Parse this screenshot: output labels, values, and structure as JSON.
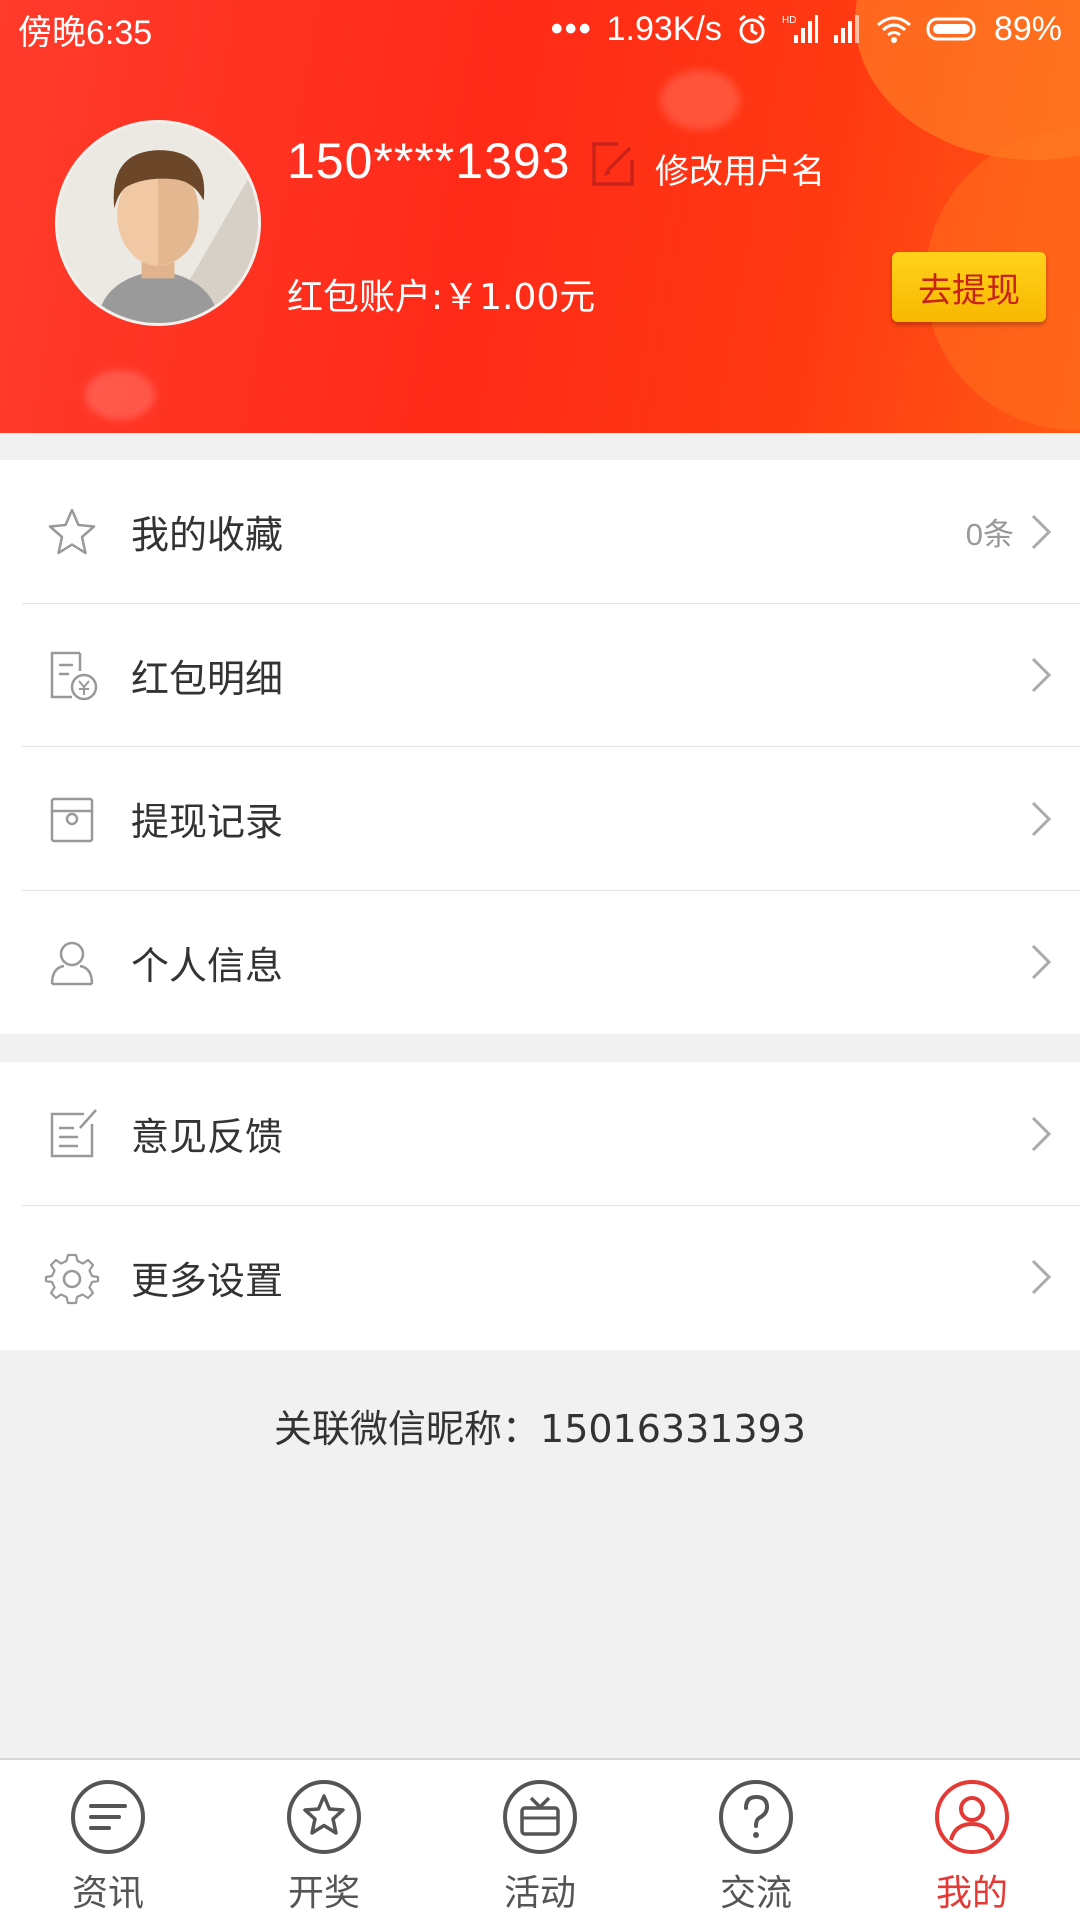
{
  "status_bar": {
    "time": "傍晚6:35",
    "network_speed": "1.93K/s",
    "battery": "89%"
  },
  "header": {
    "username": "150****1393",
    "edit_label": "修改用户名",
    "balance_label": "红包账户:￥1.00元",
    "withdraw_button": "去提现",
    "bg_color": "#ff2a18",
    "button_color": "#f7b800"
  },
  "menu_group_1": [
    {
      "label": "我的收藏",
      "count": "0条",
      "icon": "star-icon"
    },
    {
      "label": "红包明细",
      "count": "",
      "icon": "red-packet-detail-icon"
    },
    {
      "label": "提现记录",
      "count": "",
      "icon": "withdraw-record-icon"
    },
    {
      "label": "个人信息",
      "count": "",
      "icon": "person-icon"
    }
  ],
  "menu_group_2": [
    {
      "label": "意见反馈",
      "icon": "feedback-icon"
    },
    {
      "label": "更多设置",
      "icon": "gear-icon"
    }
  ],
  "wechat_text": "关联微信昵称：15016331393",
  "tabs": [
    {
      "label": "资讯",
      "icon": "news-icon",
      "active": false
    },
    {
      "label": "开奖",
      "icon": "lottery-star-icon",
      "active": false
    },
    {
      "label": "活动",
      "icon": "activity-tv-icon",
      "active": false
    },
    {
      "label": "交流",
      "icon": "question-icon",
      "active": false
    },
    {
      "label": "我的",
      "icon": "profile-icon",
      "active": true
    }
  ],
  "colors": {
    "active_tab": "#e53935",
    "inactive_tab": "#555555"
  }
}
